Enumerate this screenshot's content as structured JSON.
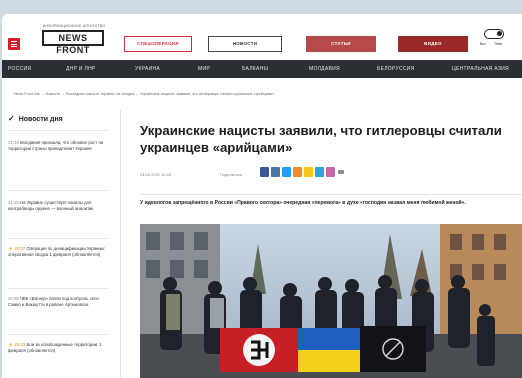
{
  "header": {
    "logo_tagline": "ИНФОРМАЦИОННОЕ АГЕНТСТВО",
    "logo_text": "NEWS FRONT",
    "buttons": [
      "СПЕЦОПЕРАЦИЯ",
      "НОВОСТИ",
      "СТАТЬИ",
      "ВИДЕО"
    ],
    "theme_labels": [
      "Вкл",
      "Тёмн"
    ]
  },
  "nav": [
    "РОССИЯ",
    "ДНР И ЛНР",
    "УКРАИНА",
    "МИР",
    "БАЛКАНЫ",
    "МОЛДАВИЯ",
    "БЕЛОРУССИЯ",
    "ЦЕНТРАЛЬНАЯ АЗИЯ"
  ],
  "breadcrumb": "News Front.info → Новости → Последние новости Украины на сегодня → Украинские нацисты заявили, что гитлеровцы считали украинцев «арийцами»",
  "sidebar": {
    "heading": "Новости дня",
    "items": [
      {
        "time": "21:35",
        "text": "Молдавия признала, что обновил рост на территории страны принадлежит Украине",
        "hot": false
      },
      {
        "time": "21:25",
        "text": "На Украине существует каналы для контрабанды оружия — военный аналитик",
        "hot": false
      },
      {
        "time": "20:57",
        "text": "Операция по денацификации Украины: оперативная сводка 1 февраля (обновляется)",
        "hot": true
      },
      {
        "time": "20:55",
        "text": "ЧВК «Вагнер» взяли под контроль село Самко и Бакшутти в районе Артемовска",
        "hot": false
      },
      {
        "time": "20:43",
        "text": "Бои за освобожденные территории: 1 февраля (обновляется)",
        "hot": true
      }
    ]
  },
  "article": {
    "title": "Украинские нацисты заявили, что гитлеровцы считали украинцев «арийцами»",
    "date": "24.02.2021 12:22",
    "share_label": "Поделиться",
    "lead": "У идеологов запрещённого в России «Правого сектора» очередная «перемога» в духе «господин назвал меня любимой женой»."
  },
  "colors": {
    "brand_red": "#d21d2a",
    "nav_bg": "#2b2e33",
    "articles_btn": "#b44a4a",
    "video_btn": "#9a2a2a"
  }
}
